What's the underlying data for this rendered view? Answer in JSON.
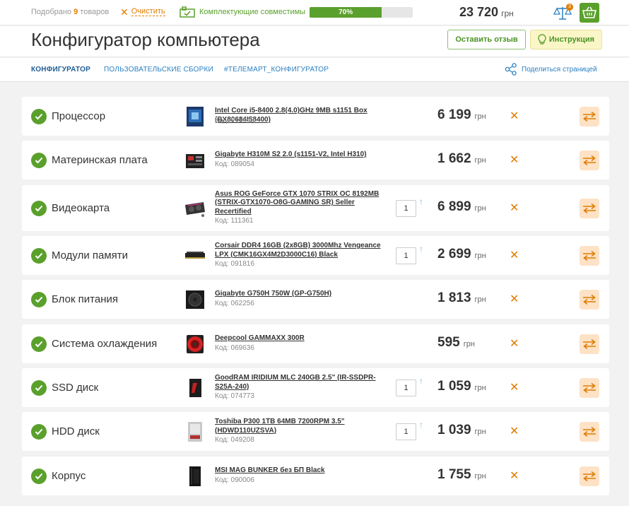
{
  "topbar": {
    "selected_prefix": "Подобрано",
    "selected_count": "9",
    "selected_suffix": "товаров",
    "clear_label": "Очистить",
    "compat_label": "Комплектующие совместимы",
    "progress_percent": 70,
    "progress_label": "70%",
    "total": "23 720",
    "currency": "грн",
    "compare_badge": "3"
  },
  "header": {
    "title": "Конфигуратор компьютера",
    "review_button": "Оставить отзыв",
    "instruction_button": "Инструкция"
  },
  "nav": {
    "tab_configurator": "Конфигуратор",
    "tab_user_builds": "Пользовательские сборки",
    "tab_hashtag": "#телемарт_конфигуратор",
    "share_label": "Поделиться страницей"
  },
  "colors": {
    "accent_green": "#5aa02c",
    "accent_orange": "#e07c00",
    "link_blue": "#2a7fc1"
  },
  "components": [
    {
      "category": "Процессор",
      "name": "Intel Core i5-8400 2.8(4.0)GHz 9MB s1151 Box (BX80684I58400)",
      "code": "Код: 071049",
      "qty": "",
      "price": "6 199",
      "currency": "грн",
      "icon": "cpu-box"
    },
    {
      "category": "Материнская плата",
      "name": "Gigabyte H310M S2 2.0 (s1151-V2, Intel H310)",
      "code": "Код: 089054",
      "qty": "",
      "price": "1 662",
      "currency": "грн",
      "icon": "motherboard"
    },
    {
      "category": "Видеокарта",
      "name": "Asus ROG GeForce GTX 1070 STRIX OC 8192MB (STRIX-GTX1070-O8G-GAMING SR) Seller Recertified",
      "code": "Код: 111361",
      "qty": "1",
      "price": "6 899",
      "currency": "грн",
      "icon": "gpu"
    },
    {
      "category": "Модули памяти",
      "name": "Corsair DDR4 16GB (2x8GB) 3000Mhz Vengeance LPX (CMK16GX4M2D3000C16) Black",
      "code": "Код: 091816",
      "qty": "1",
      "price": "2 699",
      "currency": "грн",
      "icon": "ram"
    },
    {
      "category": "Блок питания",
      "name": "Gigabyte G750H 750W (GP-G750H)",
      "code": "Код: 062256",
      "qty": "",
      "price": "1 813",
      "currency": "грн",
      "icon": "psu"
    },
    {
      "category": "Система охлаждения",
      "name": "Deepcool GAMMAXX 300R",
      "code": "Код: 069636",
      "qty": "",
      "price": "595",
      "currency": "грн",
      "icon": "cooler"
    },
    {
      "category": "SSD диск",
      "name": "GoodRAM IRIDIUM MLC 240GB 2.5\" (IR-SSDPR-S25A-240)",
      "code": "Код: 074773",
      "qty": "1",
      "price": "1 059",
      "currency": "грн",
      "icon": "ssd"
    },
    {
      "category": "HDD диск",
      "name": "Toshiba P300 1TB 64MB 7200RPM 3.5\" (HDWD110UZSVA)",
      "code": "Код: 049208",
      "qty": "1",
      "price": "1 039",
      "currency": "грн",
      "icon": "hdd"
    },
    {
      "category": "Корпус",
      "name": "MSI MAG BUNKER без БП Black",
      "code": "Код: 090006",
      "qty": "",
      "price": "1 755",
      "currency": "грн",
      "icon": "case"
    }
  ]
}
